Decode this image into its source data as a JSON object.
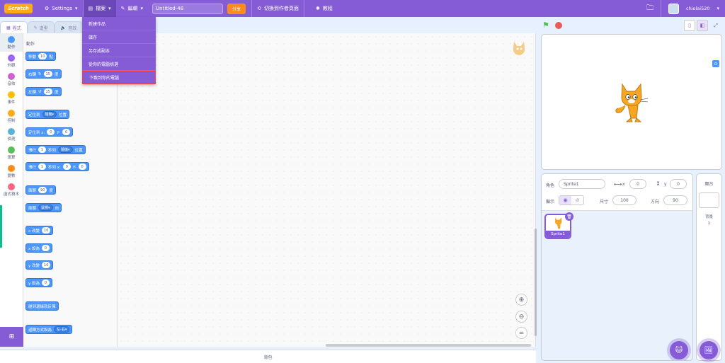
{
  "topbar": {
    "logo": "Scratch",
    "settings": "Settings",
    "file_menu": "檔案",
    "edit_menu": "編輯",
    "project_title": "Untitled-48",
    "share": "分享",
    "see_project_page": "切換到作者頁面",
    "tutorials": "教程",
    "username": "chiolai520"
  },
  "file_dropdown": {
    "items": [
      "新建作品",
      "儲存",
      "另存成副本",
      "從你的電腦挑選",
      "下載到你的電腦"
    ]
  },
  "tabs": {
    "code": "程式",
    "costumes": "造型",
    "sounds": "音效"
  },
  "categories": [
    {
      "label": "動作",
      "color": "#4c97ff"
    },
    {
      "label": "外觀",
      "color": "#9966ff"
    },
    {
      "label": "音效",
      "color": "#cf63cf"
    },
    {
      "label": "事件",
      "color": "#ffbf00"
    },
    {
      "label": "控制",
      "color": "#ffab19"
    },
    {
      "label": "偵測",
      "color": "#5cb1d6"
    },
    {
      "label": "運算",
      "color": "#59c059"
    },
    {
      "label": "變數",
      "color": "#ff8c1a"
    },
    {
      "label": "函式積木",
      "color": "#ff6680"
    }
  ],
  "palette": {
    "title": "動作",
    "move": {
      "a": "移動",
      "v": "10",
      "b": "點"
    },
    "turn_right": {
      "a": "右轉",
      "v": "15",
      "b": "度"
    },
    "turn_left": {
      "a": "左轉",
      "v": "15",
      "b": "度"
    },
    "goto": {
      "a": "定位到",
      "dd": "隨機",
      "b": "位置"
    },
    "goto_xy": {
      "a": "定位到 x:",
      "x": "0",
      "b": "y:",
      "y": "0"
    },
    "glide_to": {
      "a": "滑行",
      "v": "1",
      "b": "秒到",
      "dd": "隨機",
      "c": "位置"
    },
    "glide_xy": {
      "a": "滑行",
      "v": "1",
      "b": "秒到 x:",
      "x": "0",
      "c": "y:",
      "y": "0"
    },
    "point_dir": {
      "a": "面朝",
      "v": "90",
      "b": "度"
    },
    "point_towards": {
      "a": "面朝",
      "dd": "鼠標",
      "b": "向"
    },
    "change_x": {
      "a": "x 改變",
      "v": "10"
    },
    "set_x": {
      "a": "x 設為",
      "v": "0"
    },
    "change_y": {
      "a": "y 改變",
      "v": "10"
    },
    "set_y": {
      "a": "y 設為",
      "v": "0"
    },
    "bounce": "碰到邊緣就反彈",
    "rotation": {
      "a": "迴轉方式設為",
      "dd": "左-右"
    }
  },
  "backpack": "背包",
  "sprite_info": {
    "sprite_label": "角色",
    "sprite_name": "Sprite1",
    "x_label": "x",
    "x": "0",
    "y_label": "y",
    "y": "0",
    "show_label": "顯示",
    "size_label": "尺寸",
    "size": "100",
    "direction_label": "方向",
    "direction": "90"
  },
  "sprite_thumb": "Sprite1",
  "stage_panel": {
    "header": "舞台",
    "backdrops_label": "背景",
    "backdrops_count": "1"
  },
  "colors": {
    "accent": "#855cd6",
    "motion": "#4c97ff"
  }
}
